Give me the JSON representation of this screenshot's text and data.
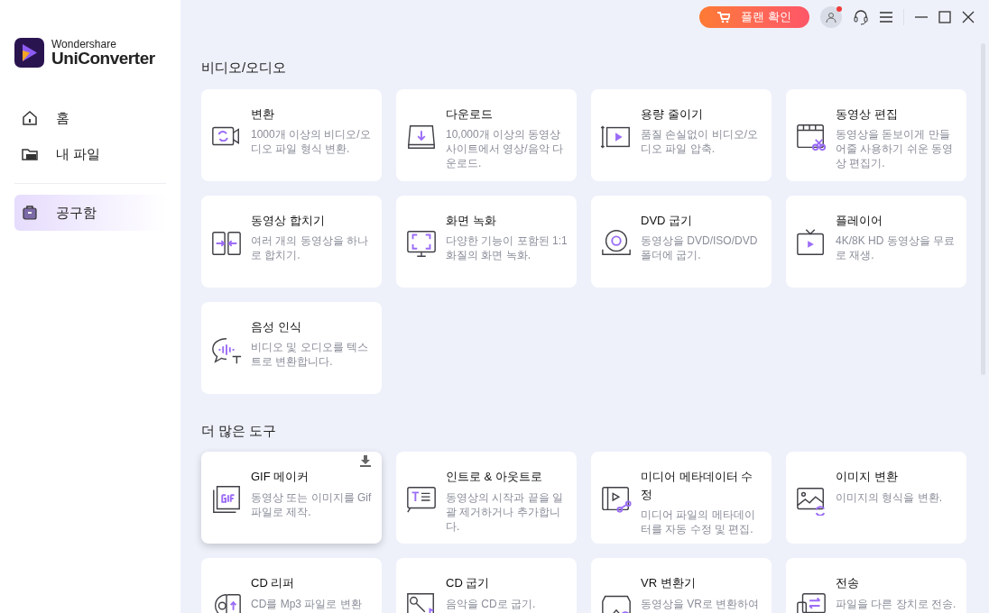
{
  "app": {
    "brand_top": "Wondershare",
    "brand_name": "UniConverter"
  },
  "sidebar": {
    "items": [
      {
        "label": "홈",
        "selected": false
      },
      {
        "label": "내 파일",
        "selected": false
      },
      {
        "label": "공구함",
        "selected": true
      }
    ]
  },
  "topbar": {
    "plan_button": "플랜 확인",
    "account_notification": true
  },
  "sections": [
    {
      "title": "비디오/오디오",
      "tools": [
        {
          "title": "변환",
          "description": "1000개 이상의 비디오/오디오 파일 형식 변환.",
          "highlighted": false,
          "download": false
        },
        {
          "title": "다운로드",
          "description": "10,000개 이상의 동영상 사이트에서 영상/음악 다운로드.",
          "highlighted": false,
          "download": false
        },
        {
          "title": "용량 줄이기",
          "description": "품질 손실없이 비디오/오디오 파일 압축.",
          "highlighted": false,
          "download": false
        },
        {
          "title": "동영상 편집",
          "description": "동영상을 돋보이게 만들어줄 사용하기 쉬운 동영상 편집기.",
          "highlighted": false,
          "download": false
        },
        {
          "title": "동영상 합치기",
          "description": "여러 개의 동영상을 하나로 합치기.",
          "highlighted": false,
          "download": false
        },
        {
          "title": "화면 녹화",
          "description": "다양한 기능이 포함된 1:1 화질의 화면 녹화.",
          "highlighted": false,
          "download": false
        },
        {
          "title": "DVD 굽기",
          "description": "동영상을 DVD/ISO/DVD 폴더에 굽기.",
          "highlighted": false,
          "download": false
        },
        {
          "title": "플레이어",
          "description": "4K/8K HD 동영상을 무료로 재생.",
          "highlighted": false,
          "download": false
        },
        {
          "title": "음성 인식",
          "description": "비디오 및 오디오를 텍스트로 변환합니다.",
          "highlighted": false,
          "download": false
        }
      ]
    },
    {
      "title": "더 많은 도구",
      "tools": [
        {
          "title": "GIF 메이커",
          "description": "동영상 또는 이미지를 Gif 파일로 제작.",
          "highlighted": true,
          "download": true
        },
        {
          "title": "인트로 & 아웃트로",
          "description": "동영상의 시작과 끝을 일괄 제거하거나 추가합니다.",
          "highlighted": false,
          "download": false
        },
        {
          "title": "미디어 메타데이터 수정",
          "description": "미디어 파일의 메타데이터를 자동 수정 및 편집.",
          "highlighted": false,
          "download": false
        },
        {
          "title": "이미지 변환",
          "description": "이미지의 형식을 변환.",
          "highlighted": false,
          "download": false
        },
        {
          "title": "CD 리퍼",
          "description": "CD를 Mp3 파일로 변환",
          "highlighted": false,
          "download": false
        },
        {
          "title": "CD 굽기",
          "description": "음악을 CD로 굽기.",
          "highlighted": false,
          "download": false
        },
        {
          "title": "VR 변환기",
          "description": "동영상을 VR로 변환하여",
          "highlighted": false,
          "download": false
        },
        {
          "title": "전송",
          "description": "파일을 다른 장치로 전송.",
          "highlighted": false,
          "download": false
        }
      ]
    }
  ]
}
